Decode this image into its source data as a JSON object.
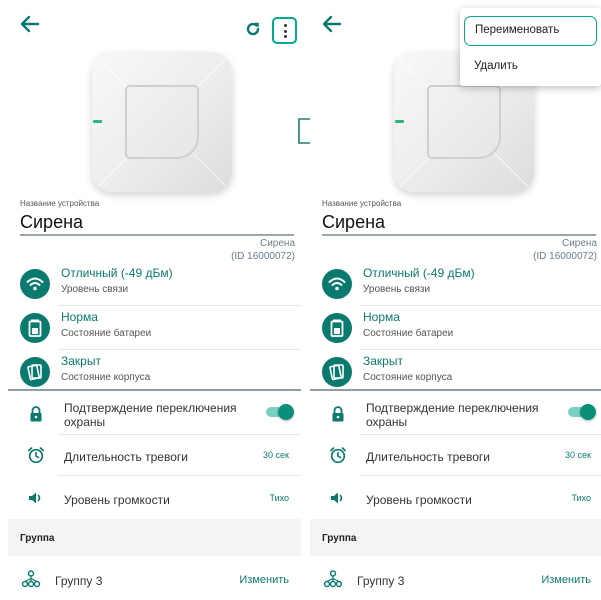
{
  "screens": [
    {
      "device": {
        "name_label": "Название устройства",
        "name_value": "Сирена",
        "meta_name": "Сирена",
        "meta_id": "(ID 16000072)"
      },
      "stats": [
        {
          "icon": "wifi-signal-icon",
          "title": "Отличный (-49 дБм)",
          "subtitle": "Уровень связи"
        },
        {
          "icon": "battery-icon",
          "title": "Норма",
          "subtitle": "Состояние батареи"
        },
        {
          "icon": "case-tamper-icon",
          "title": "Закрыт",
          "subtitle": "Состояние корпуса"
        }
      ],
      "settings": [
        {
          "icon": "lock-icon",
          "label": "Подтверждение переключения охраны",
          "toggle_on": true
        },
        {
          "icon": "alarm-clock-icon",
          "label": "Длительность тревоги",
          "value": "30 сек"
        },
        {
          "icon": "volume-icon",
          "label": "Уровень громкости",
          "value": "Тихо"
        }
      ],
      "group": {
        "section_title": "Группа",
        "icon": "group-tree-icon",
        "label": "Группу 3",
        "action": "Изменить"
      }
    },
    {
      "device": {
        "name_label": "Название устройства",
        "name_value": "Сирена",
        "meta_name": "Сирена",
        "meta_id": "(ID 16000072)"
      },
      "stats": [
        {
          "icon": "wifi-signal-icon",
          "title": "Отличный (-49 дБм)",
          "subtitle": "Уровень связи"
        },
        {
          "icon": "battery-icon",
          "title": "Норма",
          "subtitle": "Состояние батареи"
        },
        {
          "icon": "case-tamper-icon",
          "title": "Закрыт",
          "subtitle": "Состояние корпуса"
        }
      ],
      "settings": [
        {
          "icon": "lock-icon",
          "label": "Подтверждение переключения охраны",
          "toggle_on": true
        },
        {
          "icon": "alarm-clock-icon",
          "label": "Длительность тревоги",
          "value": "30 сек"
        },
        {
          "icon": "volume-icon",
          "label": "Уровень громкости",
          "value": "Тихо"
        }
      ],
      "group": {
        "section_title": "Группа",
        "icon": "group-tree-icon",
        "label": "Группу 3",
        "action": "Изменить"
      },
      "menu": {
        "items": [
          "Переименовать",
          "Удалить"
        ]
      }
    }
  ],
  "colors": {
    "accent": "#0b7a6e",
    "highlight": "#00a98f",
    "toggle_track": "#7ccfc1"
  }
}
